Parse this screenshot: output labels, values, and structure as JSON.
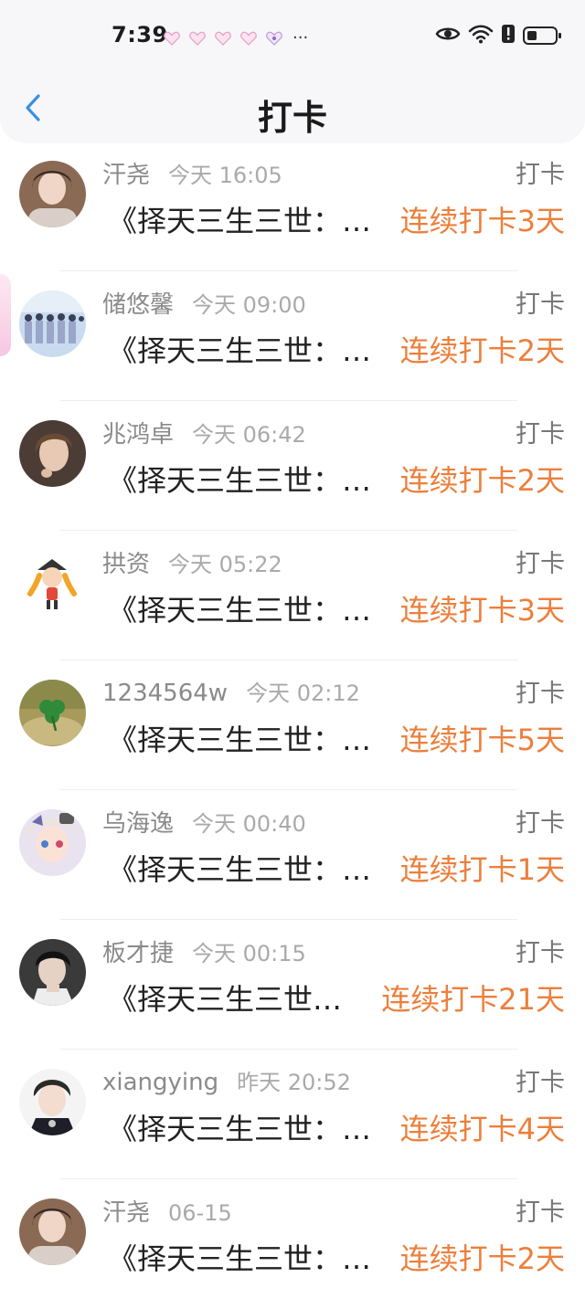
{
  "status_bar": {
    "time": "7:39",
    "more": "···"
  },
  "header": {
    "title": "打卡",
    "back_icon": "chevron-left-icon"
  },
  "colors": {
    "accent_orange": "#ec7f3c",
    "back_blue": "#3a8ee6"
  },
  "items": [
    {
      "name": "汗尧",
      "time": "今天 16:05",
      "tag": "打卡",
      "book": "《择天三生三世：…",
      "streak": "连续打卡3天"
    },
    {
      "name": "储悠馨",
      "time": "今天 09:00",
      "tag": "打卡",
      "book": "《择天三生三世：…",
      "streak": "连续打卡2天"
    },
    {
      "name": "兆鸿卓",
      "time": "今天 06:42",
      "tag": "打卡",
      "book": "《择天三生三世：…",
      "streak": "连续打卡2天"
    },
    {
      "name": "拱资",
      "time": "今天 05:22",
      "tag": "打卡",
      "book": "《择天三生三世：…",
      "streak": "连续打卡3天"
    },
    {
      "name": "1234564w",
      "time": "今天 02:12",
      "tag": "打卡",
      "book": "《择天三生三世：…",
      "streak": "连续打卡5天"
    },
    {
      "name": "乌海逸",
      "time": "今天 00:40",
      "tag": "打卡",
      "book": "《择天三生三世：…",
      "streak": "连续打卡1天"
    },
    {
      "name": "板才捷",
      "time": "今天 00:15",
      "tag": "打卡",
      "book": "《择天三生三世…",
      "streak": "连续打卡21天"
    },
    {
      "name": "xiangying",
      "time": "昨天 20:52",
      "tag": "打卡",
      "book": "《择天三生三世：…",
      "streak": "连续打卡4天"
    },
    {
      "name": "汗尧",
      "time": "06-15",
      "tag": "打卡",
      "book": "《择天三生三世：…",
      "streak": "连续打卡2天"
    }
  ]
}
